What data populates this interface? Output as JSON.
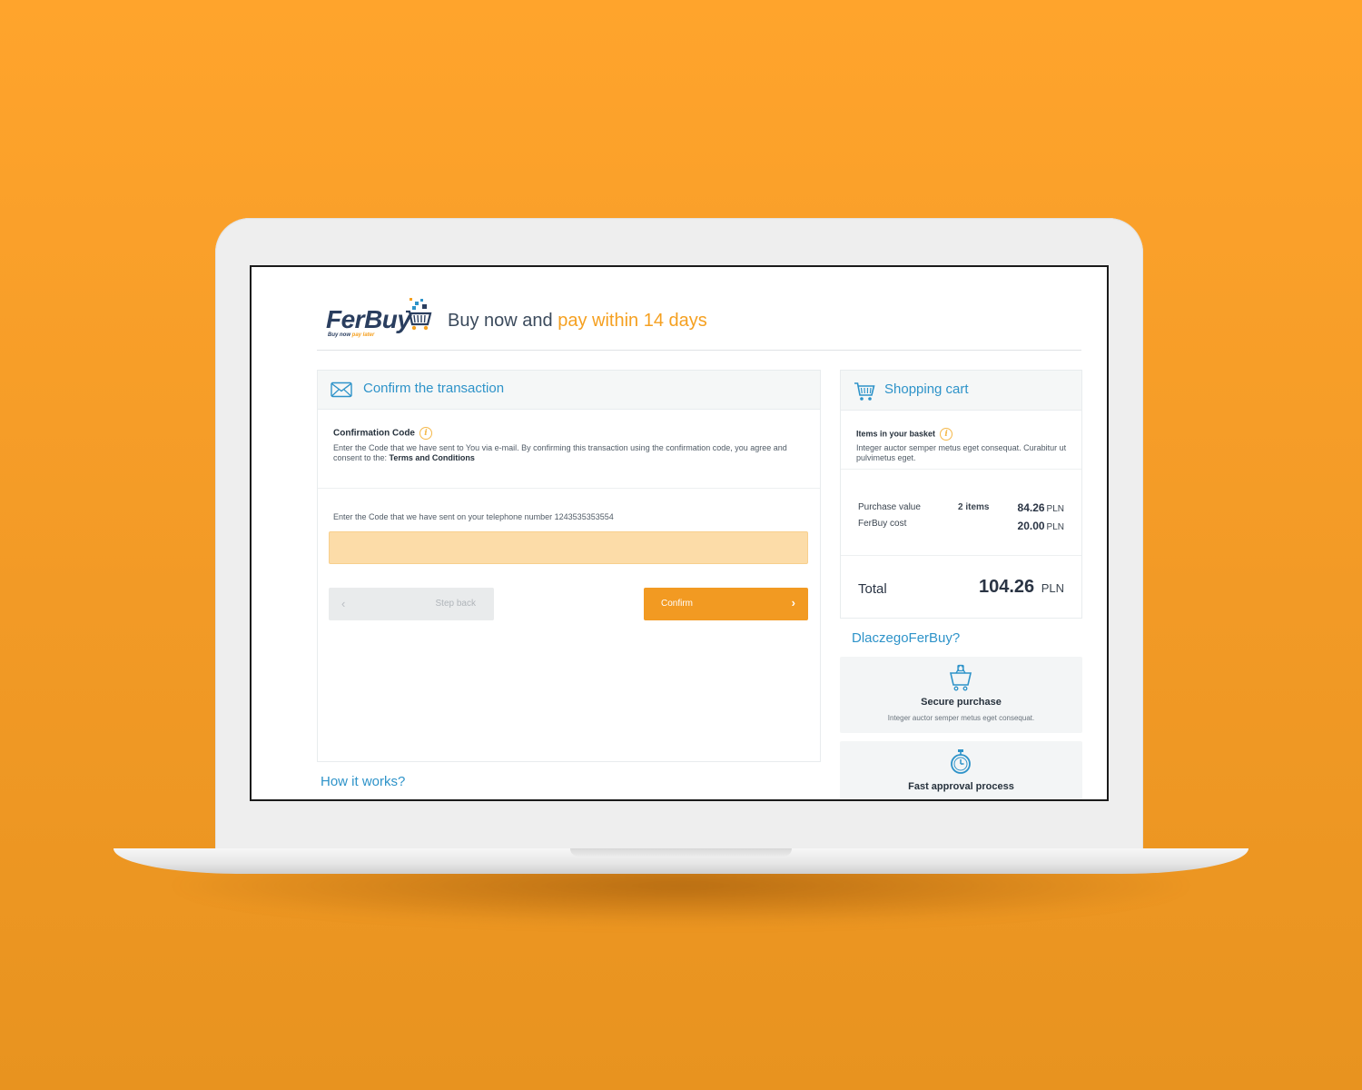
{
  "brand": {
    "logo_text": "FerBuy",
    "logo_tagline_a": "Buy now",
    "logo_tagline_b": "pay later",
    "tagline_a": "Buy now and ",
    "tagline_b": "pay within 14 days",
    "accent_color": "#f29a22",
    "link_color": "#2e93c9"
  },
  "confirm": {
    "title": "Confirm the transaction",
    "title_icon": "envelope-icon",
    "code_label": "Confirmation Code",
    "description": "Enter the Code that we have sent to You via e-mail. By confirming this transaction using the confirmation code, you agree and consent to the: ",
    "terms_link": "Terms and Conditions",
    "phone_prompt": "Enter the Code that we have sent on your telephone number 1243535353554",
    "code_value": "",
    "back_label": "Step back",
    "confirm_label": "Confirm"
  },
  "how_it_works": "How it works?",
  "cart": {
    "title": "Shopping cart",
    "title_icon": "shopping-cart-icon",
    "basket_label": "Items in your basket",
    "basket_desc": "Integer auctor semper metus eget consequat. Curabitur ut pulvimetus eget.",
    "purchase_label": "Purchase value",
    "purchase_items": "2 items",
    "purchase_value": "84.26",
    "cost_label": "FerBuy cost",
    "cost_value": "20.00",
    "currency": "PLN",
    "total_label": "Total",
    "total_value": "104.26"
  },
  "why": {
    "title": "DlaczegoFerBuy?",
    "features": [
      {
        "icon": "secure-basket-icon",
        "title": "Secure purchase",
        "desc": "Integer auctor semper metus eget consequat."
      },
      {
        "icon": "stopwatch-icon",
        "title": "Fast approval process",
        "desc": ""
      }
    ]
  }
}
